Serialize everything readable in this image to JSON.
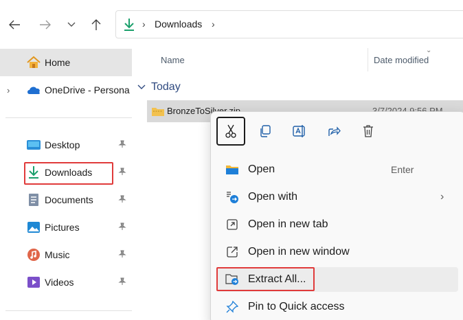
{
  "nav": {
    "back_glyph": "←",
    "forward_glyph": "→",
    "recent_glyph": "⌄",
    "up_glyph": "↑"
  },
  "address": {
    "location": "Downloads",
    "separator": "›"
  },
  "sidebar": {
    "items": [
      {
        "label": "Home",
        "icon": "home-icon",
        "expander": ""
      },
      {
        "label": "OneDrive - Persona",
        "icon": "onedrive-icon",
        "expander": "›"
      },
      {
        "label": "Desktop",
        "icon": "desktop-icon"
      },
      {
        "label": "Downloads",
        "icon": "download-icon"
      },
      {
        "label": "Documents",
        "icon": "documents-icon"
      },
      {
        "label": "Pictures",
        "icon": "pictures-icon"
      },
      {
        "label": "Music",
        "icon": "music-icon"
      },
      {
        "label": "Videos",
        "icon": "videos-icon"
      }
    ],
    "pin_glyph": "📌"
  },
  "columns": {
    "name": "Name",
    "date_modified": "Date modified",
    "sort_glyph": "⌄"
  },
  "group": {
    "label": "Today",
    "chevron": "⌄"
  },
  "file": {
    "name": "BronzeToSilver.zip",
    "date": "3/7/2024 9:56 PM"
  },
  "context_menu": {
    "quick_actions": [
      "cut-icon",
      "copy-icon",
      "rename-icon",
      "share-icon",
      "delete-icon"
    ],
    "items": [
      {
        "label": "Open",
        "shortcut": "Enter",
        "arrow": ""
      },
      {
        "label": "Open with",
        "shortcut": "",
        "arrow": "›"
      },
      {
        "label": "Open in new tab",
        "shortcut": "",
        "arrow": ""
      },
      {
        "label": "Open in new window",
        "shortcut": "",
        "arrow": ""
      },
      {
        "label": "Extract All...",
        "shortcut": "",
        "arrow": ""
      },
      {
        "label": "Pin to Quick access",
        "shortcut": "",
        "arrow": ""
      }
    ]
  },
  "colors": {
    "accent_blue": "#2f4a80",
    "highlight_red": "#e03a3a",
    "download_green": "#1a9f6b",
    "selection_gray": "#d9d9d9"
  }
}
